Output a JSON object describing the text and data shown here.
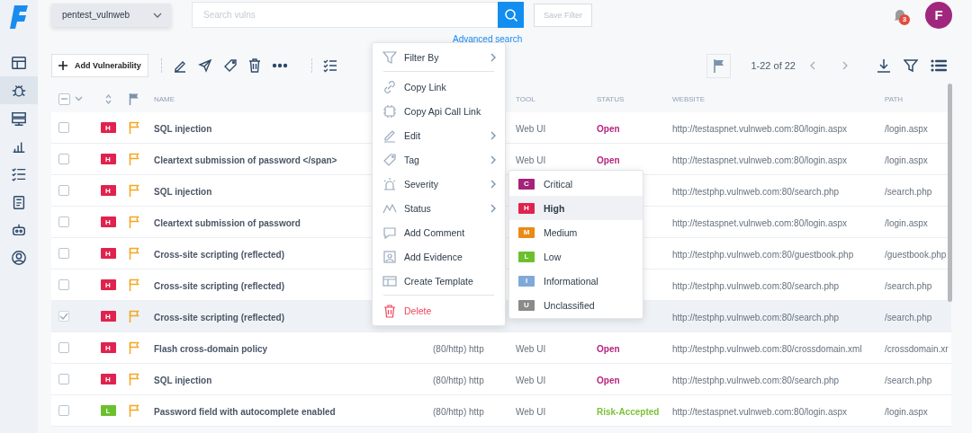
{
  "sidebar": {
    "items": [
      {
        "selected": false
      },
      {
        "selected": true
      },
      {
        "selected": false
      },
      {
        "selected": false
      },
      {
        "selected": false
      },
      {
        "selected": false
      },
      {
        "selected": false
      },
      {
        "selected": false
      }
    ]
  },
  "topbar": {
    "workspace": "pentest_vulnweb",
    "search": {
      "placeholder": "Search vulns"
    },
    "save_filter": {
      "label": "Save Filter",
      "disabled": true
    },
    "advanced_search": "Advanced search",
    "notifications": "3",
    "avatar": "F"
  },
  "toolbar": {
    "add_button": "Add Vulnerability",
    "pagination": "1-22 of 22"
  },
  "table": {
    "select_all_partial": true,
    "columns": [
      "NAME",
      "TOOL",
      "STATUS",
      "WEBSITE",
      "PATH"
    ],
    "rows": [
      {
        "checked": false,
        "hover": false,
        "severity": {
          "letter": "H",
          "color": "#e0234e"
        },
        "name": "SQL injection",
        "tool": "Web UI",
        "status": {
          "text": "Open",
          "kind": "open"
        },
        "website": "http://testaspnet.vulnweb.com:80/login.aspx",
        "path": "/login.aspx"
      },
      {
        "checked": false,
        "hover": false,
        "severity": {
          "letter": "H",
          "color": "#e0234e"
        },
        "name": "Cleartext submission of password </span>",
        "tool": "Web UI",
        "status": {
          "text": "Open",
          "kind": "open"
        },
        "website": "http://testaspnet.vulnweb.com:80/login.aspx",
        "path": "/login.aspx"
      },
      {
        "checked": false,
        "hover": false,
        "severity": {
          "letter": "H",
          "color": "#e0234e"
        },
        "name": "SQL injection",
        "website": "http://testphp.vulnweb.com:80/search.php",
        "path": "/search.php"
      },
      {
        "checked": false,
        "hover": false,
        "severity": {
          "letter": "H",
          "color": "#e0234e"
        },
        "name": "Cleartext submission of password",
        "website": "http://testaspnet.vulnweb.com:80/login.aspx",
        "path": "/login.aspx"
      },
      {
        "checked": false,
        "hover": false,
        "severity": {
          "letter": "H",
          "color": "#e0234e"
        },
        "name": "Cross-site scripting (reflected)",
        "website": "http://testphp.vulnweb.com:80/guestbook.php",
        "path": "/guestbook.php"
      },
      {
        "checked": false,
        "hover": false,
        "severity": {
          "letter": "H",
          "color": "#e0234e"
        },
        "name": "Cross-site scripting (reflected)",
        "website": "http://testphp.vulnweb.com:80/search.php",
        "path": "/search.php"
      },
      {
        "checked": true,
        "hover": true,
        "severity": {
          "letter": "H",
          "color": "#e0234e"
        },
        "name": "Cross-site scripting (reflected)",
        "website": "http://testphp.vulnweb.com:80/search.php",
        "path": "/search.php"
      },
      {
        "checked": false,
        "hover": false,
        "severity": {
          "letter": "H",
          "color": "#e0234e"
        },
        "name": "Flash cross-domain policy",
        "service": "(80/http) http",
        "tool": "Web UI",
        "status": {
          "text": "Open",
          "kind": "open"
        },
        "website": "http://testphp.vulnweb.com:80/crossdomain.xml",
        "path": "/crossdomain.xr"
      },
      {
        "checked": false,
        "hover": false,
        "severity": {
          "letter": "H",
          "color": "#e0234e"
        },
        "name": "SQL injection",
        "service": "(80/http) http",
        "tool": "Web UI",
        "status": {
          "text": "Open",
          "kind": "open"
        },
        "website": "http://testphp.vulnweb.com:80/search.php",
        "path": "/search.php"
      },
      {
        "checked": false,
        "hover": false,
        "severity": {
          "letter": "L",
          "color": "#6cbf2e"
        },
        "name": "Password field with autocomplete enabled",
        "service": "(80/http) http",
        "tool": "Web UI",
        "status": {
          "text": "Risk-Accepted",
          "kind": "accepted"
        },
        "website": "http://testaspnet.vulnweb.com:80/login.aspx",
        "path": "/login.aspx"
      }
    ]
  },
  "context_menu": {
    "groups": [
      [
        {
          "label": "Filter By",
          "kind": "normal",
          "submenu": true
        }
      ],
      [
        {
          "label": "Copy Link",
          "kind": "normal",
          "submenu": false
        },
        {
          "label": "Copy Api Call Link",
          "kind": "normal",
          "submenu": false
        },
        {
          "label": "Edit",
          "kind": "normal",
          "submenu": true
        },
        {
          "label": "Tag",
          "kind": "normal",
          "submenu": true
        },
        {
          "label": "Severity",
          "kind": "normal",
          "submenu": true
        },
        {
          "label": "Status",
          "kind": "normal",
          "submenu": true
        },
        {
          "label": "Add Comment",
          "kind": "normal",
          "submenu": false
        },
        {
          "label": "Add Evidence",
          "kind": "normal",
          "submenu": false
        },
        {
          "label": "Create Template",
          "kind": "normal",
          "submenu": false
        }
      ],
      [
        {
          "label": "Delete",
          "kind": "danger",
          "submenu": false
        }
      ]
    ]
  },
  "severity_menu": [
    {
      "letter": "C",
      "label": "Critical",
      "color": "#a4247a",
      "selected": false
    },
    {
      "letter": "H",
      "label": "High",
      "color": "#e0234e",
      "selected": true
    },
    {
      "letter": "M",
      "label": "Medium",
      "color": "#ea8a17",
      "selected": false
    },
    {
      "letter": "L",
      "label": "Low",
      "color": "#6cbf2e",
      "selected": false
    },
    {
      "letter": "I",
      "label": "Informational",
      "color": "#7fa9d8",
      "selected": false
    },
    {
      "letter": "U",
      "label": "Unclassified",
      "color": "#8a8a8a",
      "selected": false
    }
  ]
}
